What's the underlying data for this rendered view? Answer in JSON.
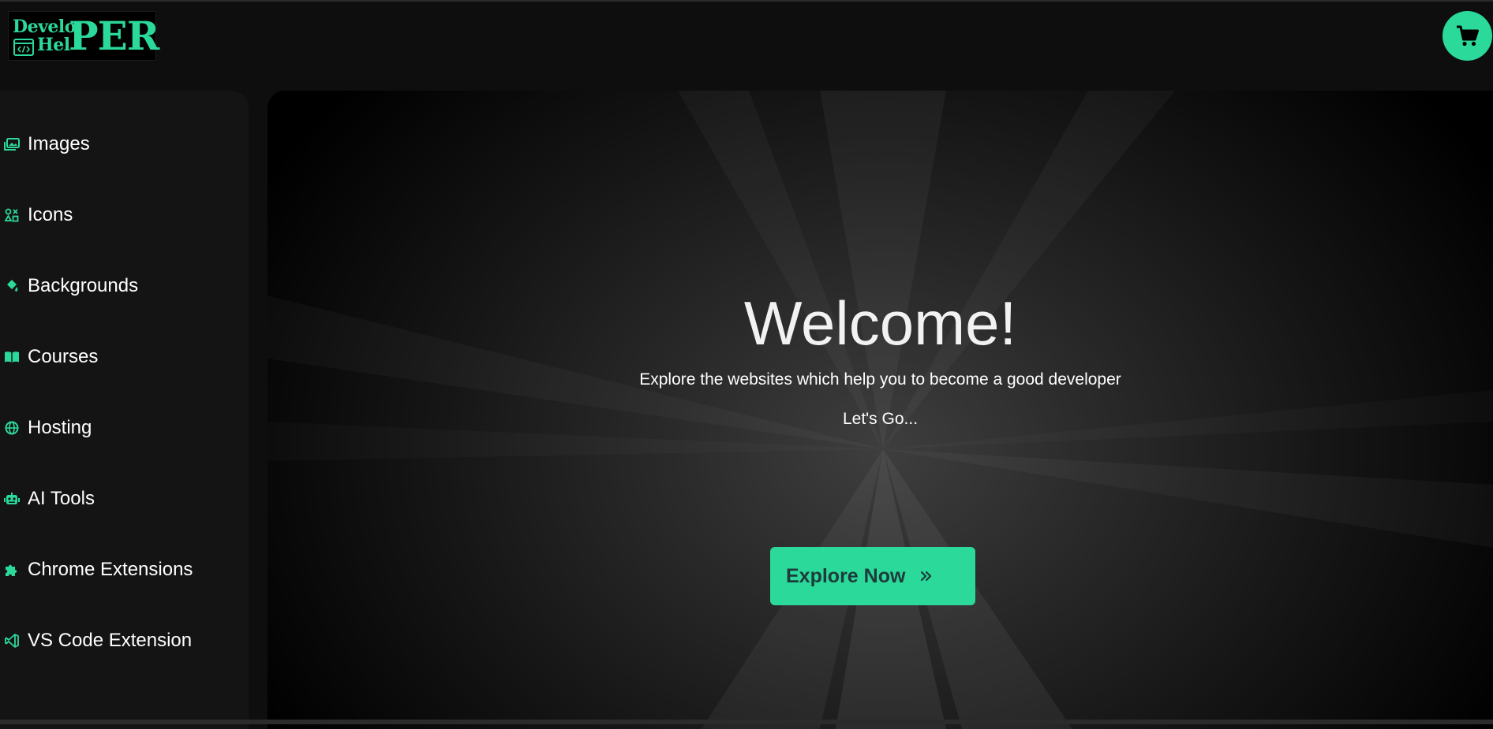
{
  "logo": {
    "line1": "Develo",
    "line2": "Hel",
    "big": "PER"
  },
  "cart": {
    "icon": "cart-icon"
  },
  "sidebar": {
    "items": [
      {
        "label": "Images",
        "icon": "images-icon"
      },
      {
        "label": "Icons",
        "icon": "shapes-icon"
      },
      {
        "label": "Backgrounds",
        "icon": "paint-bucket-icon"
      },
      {
        "label": "Courses",
        "icon": "book-icon"
      },
      {
        "label": "Hosting",
        "icon": "globe-icon"
      },
      {
        "label": "AI Tools",
        "icon": "robot-icon"
      },
      {
        "label": "Chrome Extensions",
        "icon": "puzzle-icon"
      },
      {
        "label": "VS Code Extension",
        "icon": "vscode-icon"
      }
    ]
  },
  "hero": {
    "title": "Welcome!",
    "subtitle": "Explore the websites which help you to become a good developer",
    "cta_text": "Let's Go...",
    "button_label": "Explore Now",
    "button_icon": "chevrons-right-icon"
  },
  "colors": {
    "accent": "#2bd99a",
    "background": "#0e0e0e",
    "sidebar": "#141414",
    "button_text": "#1f3a3a"
  }
}
